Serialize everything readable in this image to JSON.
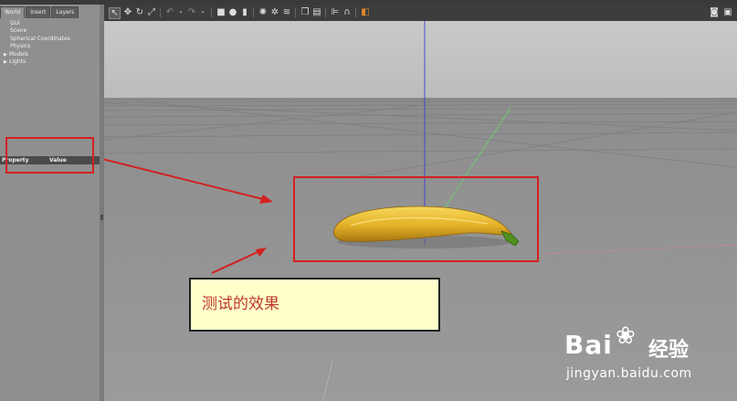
{
  "panel": {
    "tabs": [
      "World",
      "Insert",
      "Layers"
    ],
    "tree": {
      "gui": "GUI",
      "scene": "Scene",
      "spherical": "Spherical Coordinates",
      "physics": "Physics",
      "models": "Models",
      "lights": "Lights"
    },
    "property_header": "Property",
    "value_header": "Value"
  },
  "toolbar": {
    "icons": [
      "select-arrow-icon",
      "translate-icon",
      "rotate-icon",
      "scale-icon",
      "undo-icon",
      "redo-icon",
      "box-icon",
      "sphere-icon",
      "cylinder-icon",
      "sun-light-icon",
      "point-light-icon",
      "spot-light-icon",
      "copy-icon",
      "paste-icon",
      "align-icon",
      "snap-icon",
      "record-icon"
    ],
    "right_icon": "camera-icon"
  },
  "annotation": {
    "text": "测试的效果"
  },
  "watermark": {
    "brand": "Bai",
    "brand_suffix": "经验",
    "url": "jingyan.baidu.com"
  },
  "colors": {
    "highlight_red": "#d42020",
    "note_bg": "#ffffcc",
    "note_text": "#c0392b",
    "banana_yellow": "#e3b127",
    "banana_stem": "#4f8f1e"
  }
}
